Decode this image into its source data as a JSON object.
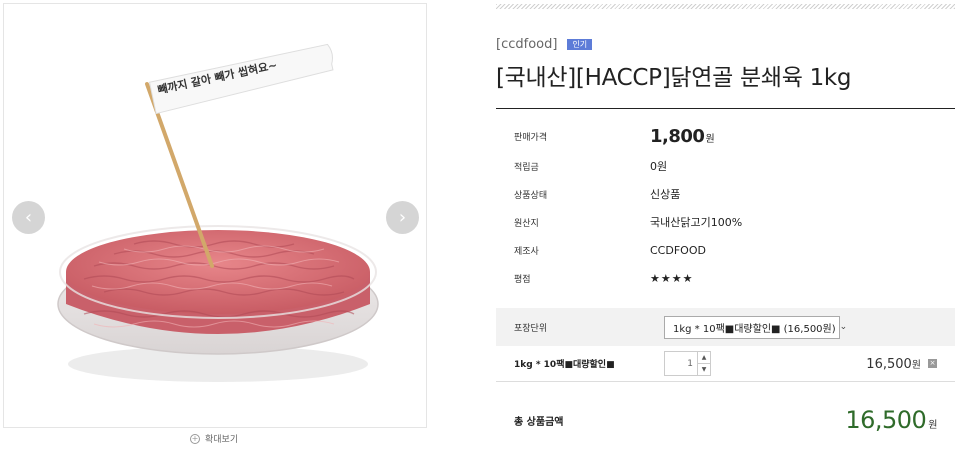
{
  "gallery": {
    "flag_text": "빼까지 갈아 빼가 씹혀요~",
    "zoom_label": "확대보기",
    "prev_icon": "chevron-left-icon",
    "next_icon": "chevron-right-icon"
  },
  "product": {
    "brand": "[ccdfood]",
    "badge": "인기",
    "title": "[국내산][HACCP]닭연골 분쇄육 1kg"
  },
  "specs": {
    "price_label": "판매가격",
    "price_value": "1,800",
    "price_unit": "원",
    "points_label": "적립금",
    "points_value": "0원",
    "condition_label": "상품상태",
    "condition_value": "신상품",
    "origin_label": "원산지",
    "origin_value": "국내산닭고기100%",
    "maker_label": "제조사",
    "maker_value": "CCDFOOD",
    "rating_label": "평점",
    "rating_value": "★★★★"
  },
  "option": {
    "label": "포장단위",
    "selected": "1kg * 10팩■대량할인■ (16,500원)"
  },
  "selected_item": {
    "name": "1kg * 10팩■대량할인■",
    "quantity": "1",
    "price": "16,500",
    "price_unit": "원"
  },
  "total": {
    "label": "총 상품금액",
    "value": "16,500",
    "unit": "원"
  },
  "colors": {
    "badge": "#5d7cd8",
    "total_price": "#2f6b2a"
  }
}
